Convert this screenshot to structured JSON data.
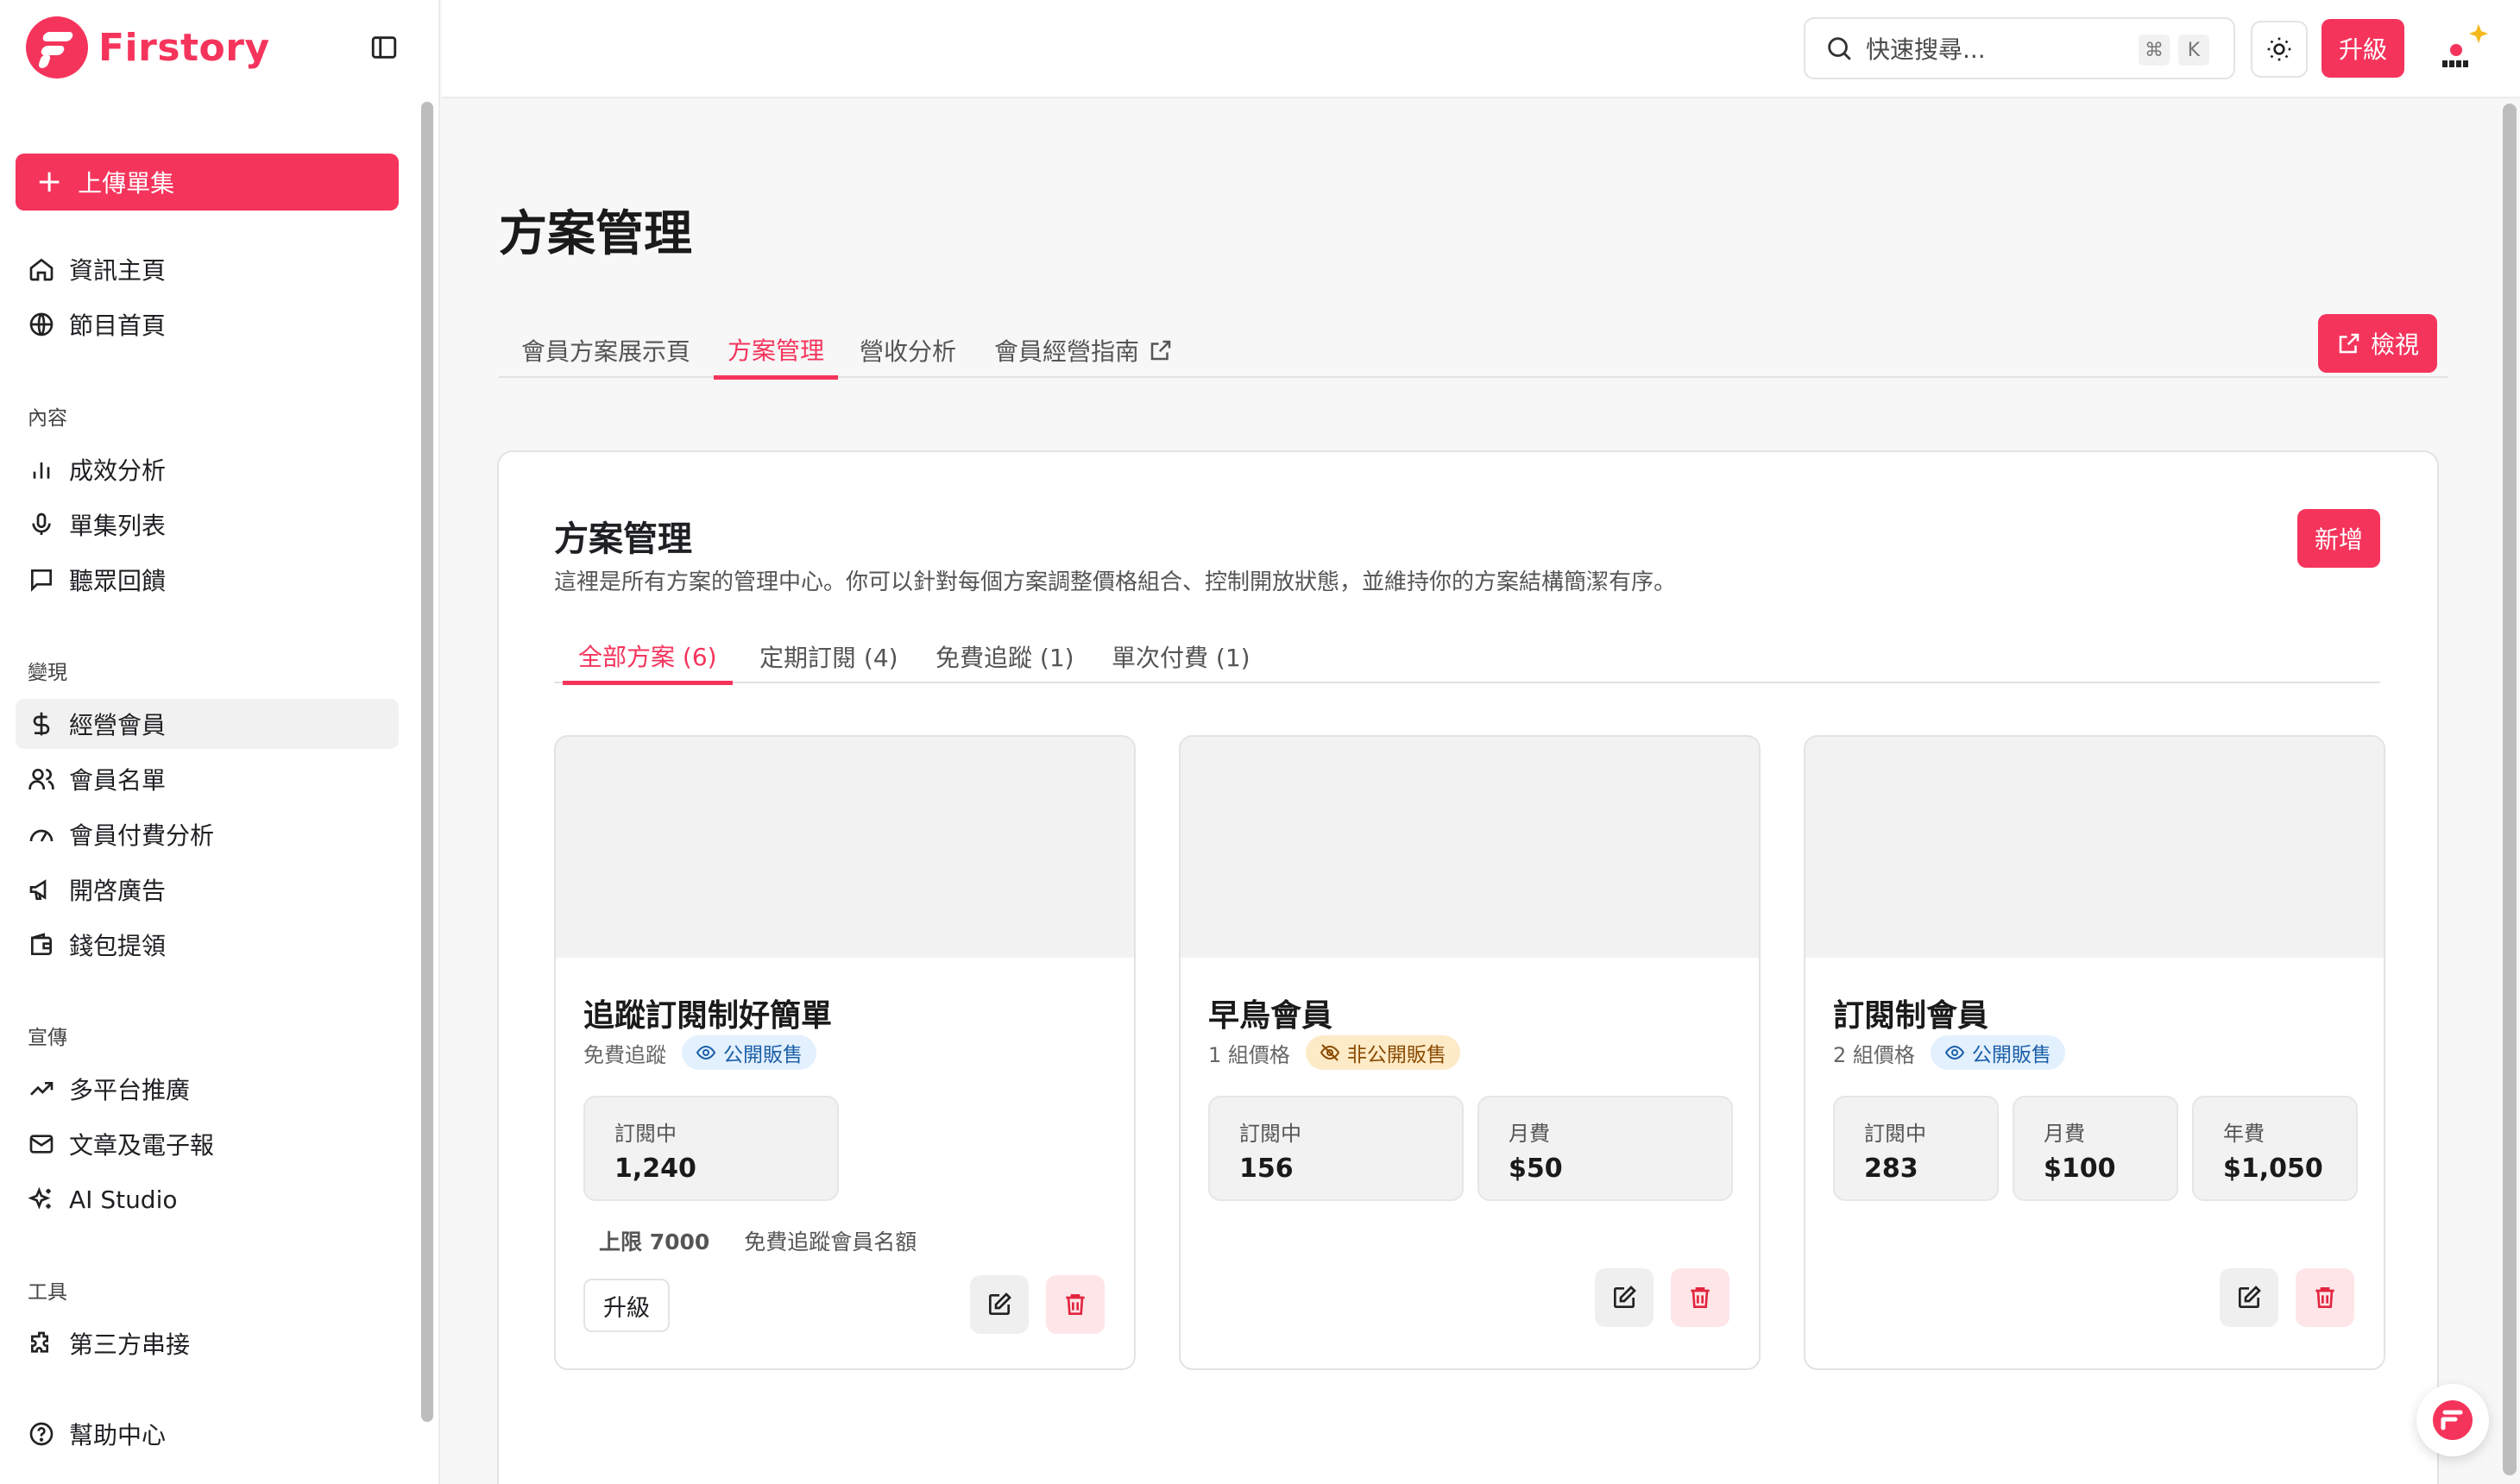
{
  "brand": {
    "name": "Firstory",
    "color": "#f5345c"
  },
  "sidebar": {
    "upload_label": "上傳單集",
    "top_items": [
      {
        "label": "資訊主頁",
        "icon": "home-icon"
      },
      {
        "label": "節目首頁",
        "icon": "globe-icon"
      }
    ],
    "sections": [
      {
        "title": "內容",
        "items": [
          {
            "label": "成效分析",
            "icon": "bar-chart-icon"
          },
          {
            "label": "單集列表",
            "icon": "microphone-icon"
          },
          {
            "label": "聽眾回饋",
            "icon": "message-icon"
          }
        ]
      },
      {
        "title": "變現",
        "items": [
          {
            "label": "經營會員",
            "icon": "dollar-icon",
            "active": true
          },
          {
            "label": "會員名單",
            "icon": "users-icon"
          },
          {
            "label": "會員付費分析",
            "icon": "gauge-icon"
          },
          {
            "label": "開啓廣告",
            "icon": "megaphone-icon"
          },
          {
            "label": "錢包提領",
            "icon": "wallet-icon"
          }
        ]
      },
      {
        "title": "宣傳",
        "items": [
          {
            "label": "多平台推廣",
            "icon": "trending-up-icon"
          },
          {
            "label": "文章及電子報",
            "icon": "mail-icon"
          },
          {
            "label": "AI Studio",
            "icon": "sparkles-icon"
          }
        ]
      },
      {
        "title": "工具",
        "items": [
          {
            "label": "第三方串接",
            "icon": "puzzle-icon"
          }
        ]
      }
    ],
    "help_label": "幫助中心"
  },
  "topbar": {
    "search_placeholder": "快速搜尋...",
    "shortcut_keys": [
      "⌘",
      "K"
    ],
    "upgrade_label": "升級"
  },
  "page": {
    "title": "方案管理",
    "tabs": [
      {
        "label": "會員方案展示頁"
      },
      {
        "label": "方案管理",
        "active": true
      },
      {
        "label": "營收分析"
      },
      {
        "label": "會員經營指南",
        "external": true
      }
    ],
    "view_label": "檢視"
  },
  "panel": {
    "title": "方案管理",
    "description": "這裡是所有方案的管理中心。你可以針對每個方案調整價格組合、控制開放狀態，並維持你的方案結構簡潔有序。",
    "add_label": "新增",
    "filters": [
      {
        "label": "全部方案 (6)",
        "active": true
      },
      {
        "label": "定期訂閱 (4)"
      },
      {
        "label": "免費追蹤 (1)"
      },
      {
        "label": "單次付費 (1)"
      }
    ]
  },
  "plans": [
    {
      "name": "追蹤訂閱制好簡單",
      "meta": "免費追蹤",
      "badge": "公開販售",
      "badge_type": "public",
      "stats": [
        {
          "label": "訂閱中",
          "value": "1,240"
        }
      ],
      "limit_value": "上限 7000",
      "limit_text": "免費追蹤會員名額",
      "upgrade_label": "升級"
    },
    {
      "name": "早鳥會員",
      "meta": "1 組價格",
      "badge": "非公開販售",
      "badge_type": "private",
      "stats": [
        {
          "label": "訂閱中",
          "value": "156"
        },
        {
          "label": "月費",
          "value": "$50"
        }
      ]
    },
    {
      "name": "訂閱制會員",
      "meta": "2 組價格",
      "badge": "公開販售",
      "badge_type": "public",
      "stats": [
        {
          "label": "訂閱中",
          "value": "283"
        },
        {
          "label": "月費",
          "value": "$100"
        },
        {
          "label": "年費",
          "value": "$1,050"
        }
      ]
    }
  ]
}
